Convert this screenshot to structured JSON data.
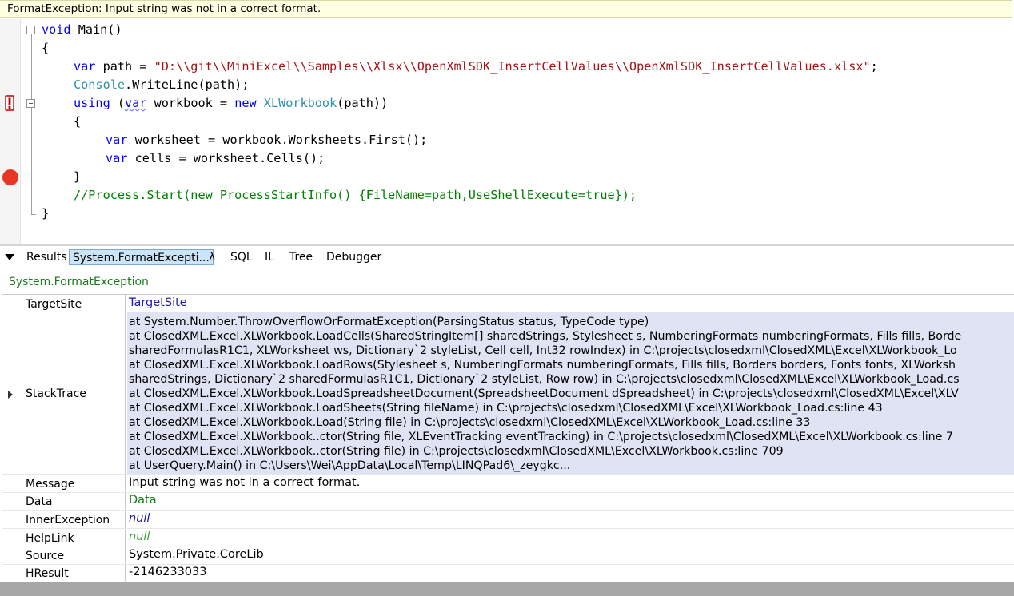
{
  "error_bar": {
    "message": "FormatException: Input string was not in a correct format."
  },
  "code": {
    "line1": {
      "kw": "void",
      "rest": " Main()"
    },
    "line2": "{",
    "line3": {
      "kw": "var",
      "mid": " path = ",
      "str": "\"D:\\\\git\\\\MiniExcel\\\\Samples\\\\Xlsx\\\\OpenXmlSDK_InsertCellValues\\\\OpenXmlSDK_InsertCellValues.xlsx\"",
      "end": ";"
    },
    "line4": {
      "type": "Console",
      "rest": ".WriteLine(path);"
    },
    "line5": {
      "kw1": "using",
      "p1": " (",
      "kw2": "var",
      "p2": " workbook = ",
      "kw3": "new",
      "p3": " ",
      "type": "XLWorkbook",
      "p4": "(path))"
    },
    "line6": "{",
    "line7": {
      "kw": "var",
      "rest": " worksheet = workbook.Worksheets.First();"
    },
    "line8": {
      "kw": "var",
      "rest": " cells = worksheet.Cells();"
    },
    "line9": "}",
    "line10": "//Process.Start(new ProcessStartInfo() {FileName=path,UseShellExecute=true});",
    "line11": "}"
  },
  "tabs": {
    "results": "Results",
    "exception": "System.FormatExcepti...",
    "lambda": "λ",
    "sql": "SQL",
    "il": "IL",
    "tree": "Tree",
    "debugger": "Debugger"
  },
  "result_header": "System.FormatException",
  "table": {
    "target_site": {
      "key": "TargetSite",
      "value": "TargetSite"
    },
    "stack_trace": {
      "key": "StackTrace",
      "lines": [
        "   at System.Number.ThrowOverflowOrFormatException(ParsingStatus status, TypeCode type)",
        "   at ClosedXML.Excel.XLWorkbook.LoadCells(SharedStringItem[] sharedStrings, Stylesheet s, NumberingFormats numberingFormats, Fills fills, Borde",
        "sharedFormulasR1C1, XLWorksheet ws, Dictionary`2 styleList, Cell cell, Int32 rowIndex) in C:\\projects\\closedxml\\ClosedXML\\Excel\\XLWorkbook_Lo",
        "   at ClosedXML.Excel.XLWorkbook.LoadRows(Stylesheet s, NumberingFormats numberingFormats, Fills fills, Borders borders, Fonts fonts, XLWorksh",
        "sharedStrings, Dictionary`2 sharedFormulasR1C1, Dictionary`2 styleList, Row row) in C:\\projects\\closedxml\\ClosedXML\\Excel\\XLWorkbook_Load.cs",
        "   at ClosedXML.Excel.XLWorkbook.LoadSpreadsheetDocument(SpreadsheetDocument dSpreadsheet) in C:\\projects\\closedxml\\ClosedXML\\Excel\\XLV",
        "   at ClosedXML.Excel.XLWorkbook.LoadSheets(String fileName) in C:\\projects\\closedxml\\ClosedXML\\Excel\\XLWorkbook_Load.cs:line 43",
        "   at ClosedXML.Excel.XLWorkbook.Load(String file) in C:\\projects\\closedxml\\ClosedXML\\Excel\\XLWorkbook_Load.cs:line 33",
        "   at ClosedXML.Excel.XLWorkbook..ctor(String file, XLEventTracking eventTracking) in C:\\projects\\closedxml\\ClosedXML\\Excel\\XLWorkbook.cs:line 7",
        "   at ClosedXML.Excel.XLWorkbook..ctor(String file) in C:\\projects\\closedxml\\ClosedXML\\Excel\\XLWorkbook.cs:line 709",
        "   at UserQuery.Main() in C:\\Users\\Wei\\AppData\\Local\\Temp\\LINQPad6\\_zeygkc..."
      ]
    },
    "message": {
      "key": "Message",
      "value": "Input string was not in a correct format."
    },
    "data": {
      "key": "Data",
      "value": "Data"
    },
    "inner_exception": {
      "key": "InnerException",
      "value": "null"
    },
    "help_link": {
      "key": "HelpLink",
      "value": "null"
    },
    "source": {
      "key": "Source",
      "value": "System.Private.CoreLib"
    },
    "hresult": {
      "key": "HResult",
      "value": "-2146233033"
    }
  },
  "icons": [
    "breakpoint-icon",
    "exception-marker-icon",
    "fold-icon",
    "collapse-triangle-icon",
    "expand-triangle-icon"
  ]
}
